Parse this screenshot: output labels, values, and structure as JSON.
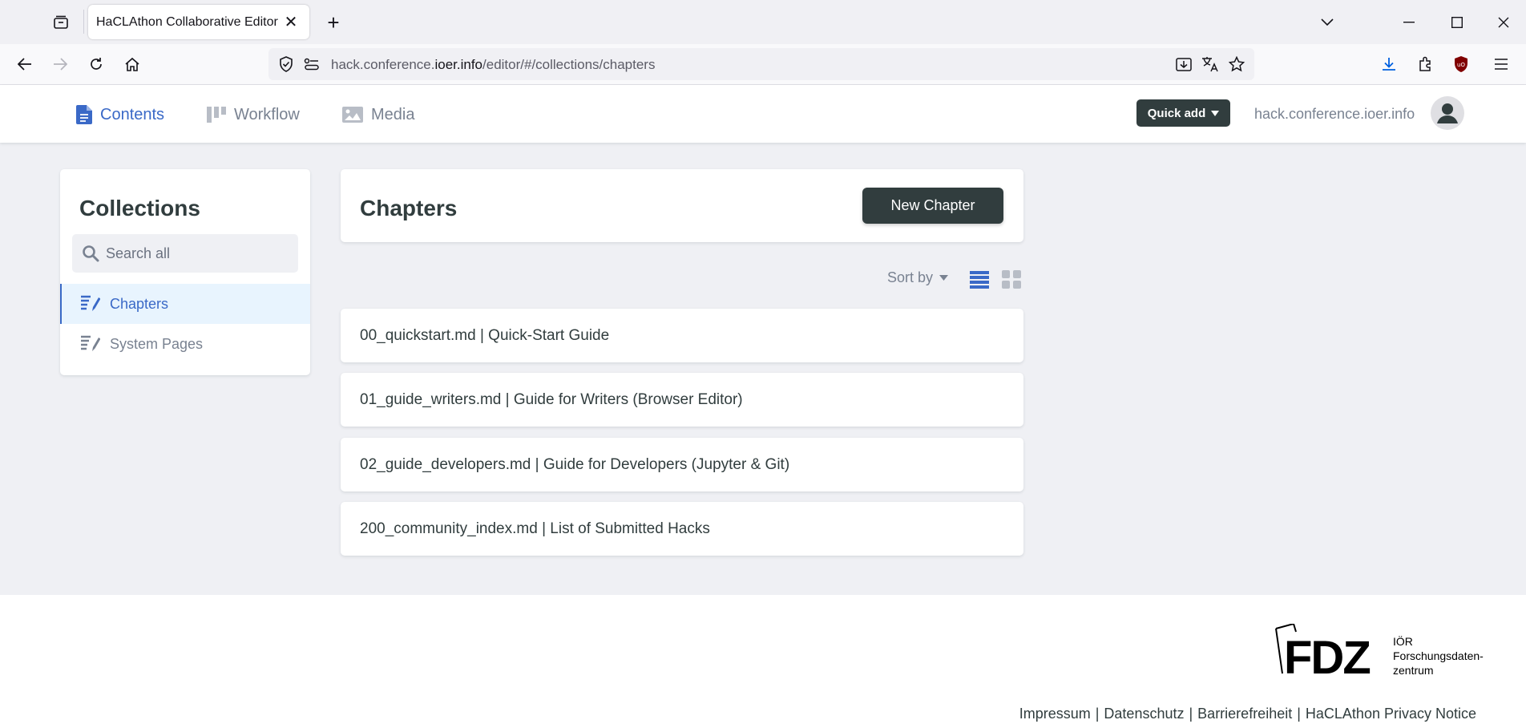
{
  "browser": {
    "tab_title": "HaCLAthon Collaborative Editor",
    "url_prefix": "hack.conference.",
    "url_domain": "ioer.info",
    "url_path": "/editor/#/collections/chapters"
  },
  "header": {
    "tabs": [
      {
        "label": "Contents",
        "icon": "document-icon",
        "active": true
      },
      {
        "label": "Workflow",
        "icon": "kanban-icon",
        "active": false
      },
      {
        "label": "Media",
        "icon": "image-icon",
        "active": false
      }
    ],
    "quick_add_label": "Quick add",
    "site_link": "hack.conference.ioer.info"
  },
  "sidebar": {
    "title": "Collections",
    "search_placeholder": "Search all",
    "items": [
      {
        "label": "Chapters",
        "icon": "edit-list-icon",
        "active": true
      },
      {
        "label": "System Pages",
        "icon": "edit-list-icon",
        "active": false
      }
    ]
  },
  "main": {
    "title": "Chapters",
    "new_button_label": "New Chapter",
    "sort_label": "Sort by",
    "view_mode": "list",
    "entries": [
      "00_quickstart.md | Quick-Start Guide",
      "01_guide_writers.md | Guide for Writers (Browser Editor)",
      "02_guide_developers.md | Guide for Developers (Jupyter & Git)",
      "200_community_index.md | List of Submitted Hacks"
    ]
  },
  "footer": {
    "logo_text": "FDZ",
    "logo_caption_1": "IÖR",
    "logo_caption_2": "Forschungsdaten-",
    "logo_caption_3": "zentrum",
    "links": [
      "Impressum",
      "Datenschutz",
      "Barrierefreiheit",
      "HaCLAthon Privacy Notice"
    ]
  },
  "colors": {
    "accent": "#3a69c7",
    "dark_button": "#313d3e",
    "background": "#eff0f4",
    "muted_text": "#798291"
  }
}
